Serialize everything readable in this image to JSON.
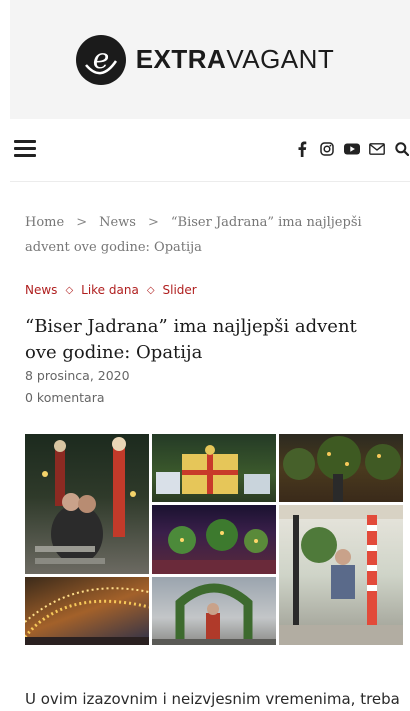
{
  "header": {
    "logo_letter": "e",
    "logo_bold": "EXTRA",
    "logo_light": "VAGANT"
  },
  "nav": {
    "icons": [
      "menu-icon",
      "facebook-icon",
      "instagram-icon",
      "youtube-icon",
      "mail-icon",
      "search-icon"
    ]
  },
  "breadcrumb": {
    "home": "Home",
    "sep": ">",
    "news": "News",
    "current": "“Biser Jadrana” ima najljepši advent ove godine: Opatija"
  },
  "article": {
    "categories": [
      "News",
      "Like dana",
      "Slider"
    ],
    "category_separator": "◇",
    "title": "“Biser Jadrana” ima najljepši advent ove godine: Opatija",
    "date": "8 prosinca, 2020",
    "comments": "0 komentara",
    "intro": "U ovim izazovnim i neizvjesnim vremenima, treba"
  },
  "colors": {
    "accent": "#b01f1f",
    "logo_band": "#f4f4f4",
    "text": "#1b1b1b"
  }
}
